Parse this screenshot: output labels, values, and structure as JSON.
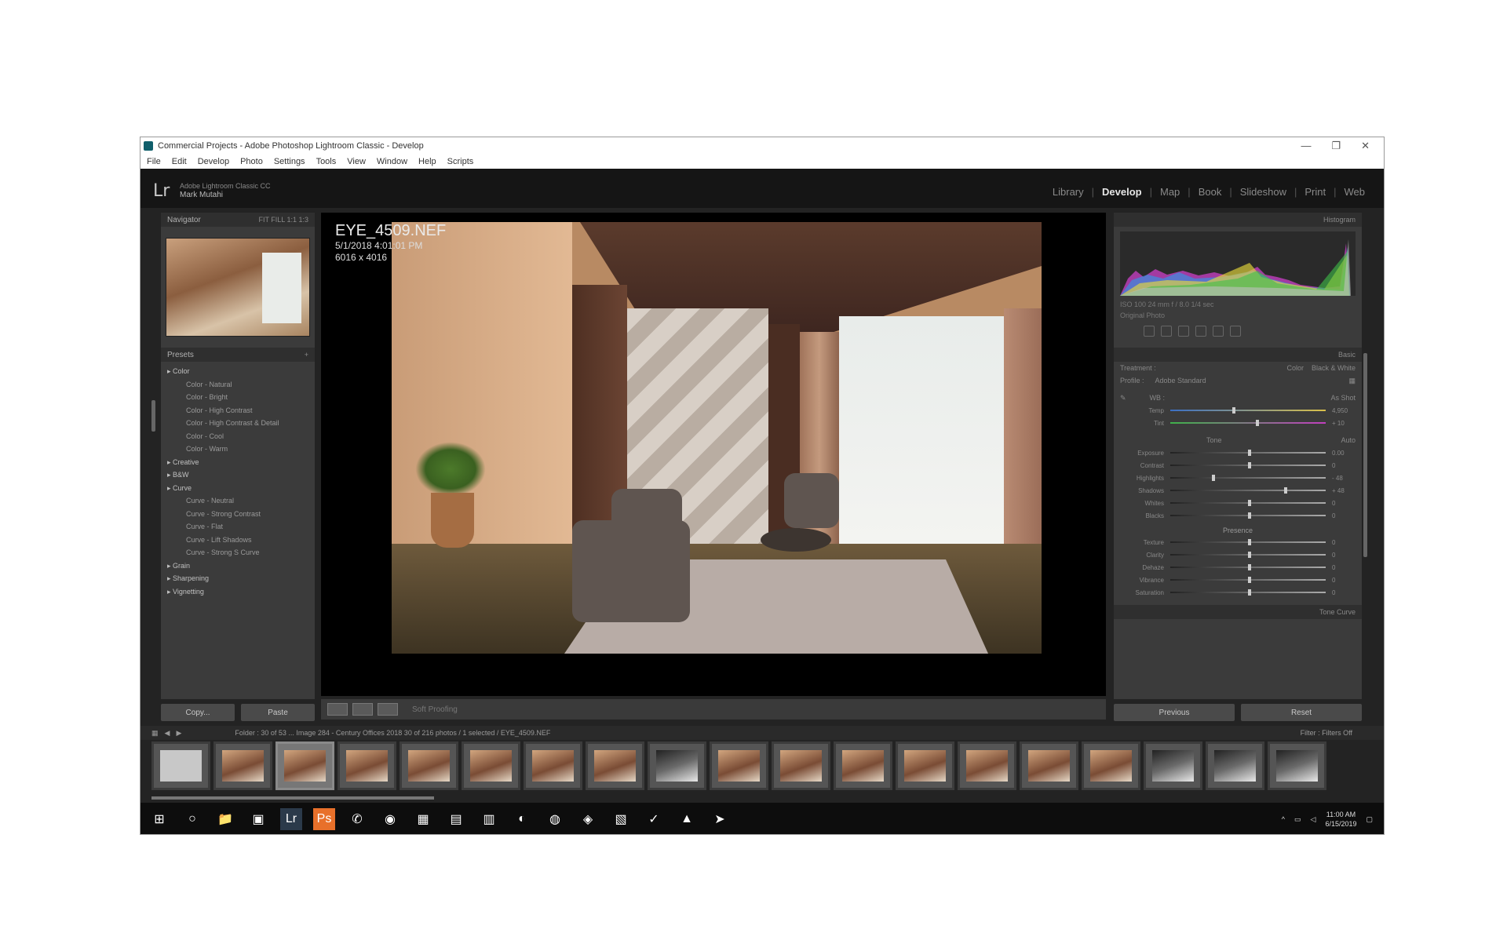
{
  "window": {
    "title": "Commercial Projects - Adobe Photoshop Lightroom Classic - Develop",
    "controls": [
      "—",
      "❐",
      "✕"
    ]
  },
  "menu": [
    "File",
    "Edit",
    "Develop",
    "Photo",
    "Settings",
    "Tools",
    "View",
    "Window",
    "Help",
    "Scripts"
  ],
  "identity": {
    "logo": "Lr",
    "line1": "Adobe Lightroom Classic CC",
    "name": "Mark Mutahi"
  },
  "modules": [
    {
      "label": "Library",
      "active": false
    },
    {
      "label": "Develop",
      "active": true
    },
    {
      "label": "Map",
      "active": false
    },
    {
      "label": "Book",
      "active": false
    },
    {
      "label": "Slideshow",
      "active": false
    },
    {
      "label": "Print",
      "active": false
    },
    {
      "label": "Web",
      "active": false
    }
  ],
  "left": {
    "navigator": {
      "title": "Navigator",
      "zoom": "FIT  FILL  1:1  1:3"
    },
    "presets": {
      "title": "Presets",
      "groups": [
        {
          "name": "Color",
          "items": [
            "Color - Natural",
            "Color - Bright",
            "Color - High Contrast",
            "Color - High Contrast & Detail",
            "Color - Cool",
            "Color - Warm"
          ]
        },
        {
          "name": "Creative",
          "items": []
        },
        {
          "name": "B&W",
          "items": []
        },
        {
          "name": "Curve",
          "items": [
            "Curve - Neutral",
            "Curve - Strong Contrast",
            "Curve - Flat",
            "Curve - Lift Shadows",
            "Curve - Strong S Curve"
          ]
        },
        {
          "name": "Grain",
          "items": []
        },
        {
          "name": "Sharpening",
          "items": []
        },
        {
          "name": "Vignetting",
          "items": []
        }
      ]
    },
    "buttons": {
      "copy": "Copy...",
      "paste": "Paste"
    }
  },
  "photo": {
    "filename": "EYE_4509.NEF",
    "date": "5/1/2018 4:01:01 PM",
    "dimensions": "6016 x 4016"
  },
  "toolbar": {
    "soft_proofing": "Soft Proofing"
  },
  "right": {
    "histogram": {
      "title": "Histogram",
      "readout": "ISO 100    24 mm    f / 8.0    1/4 sec",
      "original": "Original Photo"
    },
    "basic": {
      "title": "Basic",
      "treatment_label": "Treatment :",
      "treatment_color": "Color",
      "treatment_bw": "Black & White",
      "profile_label": "Profile :",
      "profile_value": "Adobe Standard",
      "wb_label": "WB :",
      "wb_value": "As Shot",
      "temp_label": "Temp",
      "temp_value": "4,950",
      "tint_label": "Tint",
      "tint_value": "+ 10",
      "tone_label": "Tone",
      "tone_auto": "Auto",
      "tone_sliders": [
        {
          "label": "Exposure",
          "value": "0.00",
          "pos": 0.5
        },
        {
          "label": "Contrast",
          "value": "0",
          "pos": 0.5
        },
        {
          "label": "Highlights",
          "value": "- 48",
          "pos": 0.27
        },
        {
          "label": "Shadows",
          "value": "+ 48",
          "pos": 0.73
        },
        {
          "label": "Whites",
          "value": "0",
          "pos": 0.5
        },
        {
          "label": "Blacks",
          "value": "0",
          "pos": 0.5
        }
      ],
      "presence_label": "Presence",
      "presence_sliders": [
        {
          "label": "Texture",
          "value": "0",
          "pos": 0.5
        },
        {
          "label": "Clarity",
          "value": "0",
          "pos": 0.5
        },
        {
          "label": "Dehaze",
          "value": "0",
          "pos": 0.5
        },
        {
          "label": "Vibrance",
          "value": "0",
          "pos": 0.5
        },
        {
          "label": "Saturation",
          "value": "0",
          "pos": 0.5
        }
      ]
    },
    "tone_curve": "Tone Curve",
    "buttons": {
      "previous": "Previous",
      "reset": "Reset"
    }
  },
  "filmbar": {
    "path": "Folder : 30 of 53 ... Image 284 - Century Offices 2018    30 of 216 photos / 1 selected / EYE_4509.NEF",
    "filter": "Filter :",
    "filter_value": "Filters Off"
  },
  "filmstrip": {
    "count": 19,
    "selected_index": 2,
    "dark_indices": [
      8,
      16,
      17,
      18
    ],
    "blank_indices": [
      0
    ]
  },
  "taskbar": {
    "apps": [
      "⊞",
      "○",
      "📁",
      "▣",
      "Lr",
      "Ps",
      "✆",
      "◉",
      "▦",
      "▤",
      "▥",
      "◐",
      "◍",
      "◈",
      "▧",
      "✓",
      "▲",
      "➤"
    ],
    "time": "11:00 AM",
    "date": "6/15/2019"
  }
}
